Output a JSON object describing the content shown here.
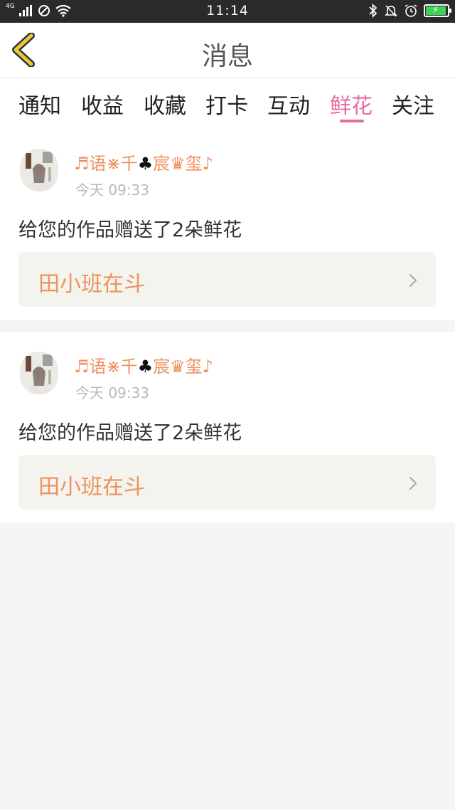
{
  "status_bar": {
    "network_label": "4G",
    "time": "11:14"
  },
  "header": {
    "title": "消息"
  },
  "tabs": [
    {
      "label": "通知"
    },
    {
      "label": "收益"
    },
    {
      "label": "收藏"
    },
    {
      "label": "打卡"
    },
    {
      "label": "互动"
    },
    {
      "label": "鲜花",
      "active": true
    },
    {
      "label": "关注"
    }
  ],
  "colors": {
    "accent_pink": "#e86ba1",
    "orange_text": "#f09060",
    "back_arrow": "#e8c838"
  },
  "messages": [
    {
      "name_part1": "♬语⋇千",
      "name_club": "♣",
      "name_part2": "宸♛玺♪",
      "time": "今天 09:33",
      "text": "给您的作品赠送了2朵鲜花",
      "work_title": "田小班在斗"
    },
    {
      "name_part1": "♬语⋇千",
      "name_club": "♣",
      "name_part2": "宸♛玺♪",
      "time": "今天 09:33",
      "text": "给您的作品赠送了2朵鲜花",
      "work_title": "田小班在斗"
    }
  ]
}
